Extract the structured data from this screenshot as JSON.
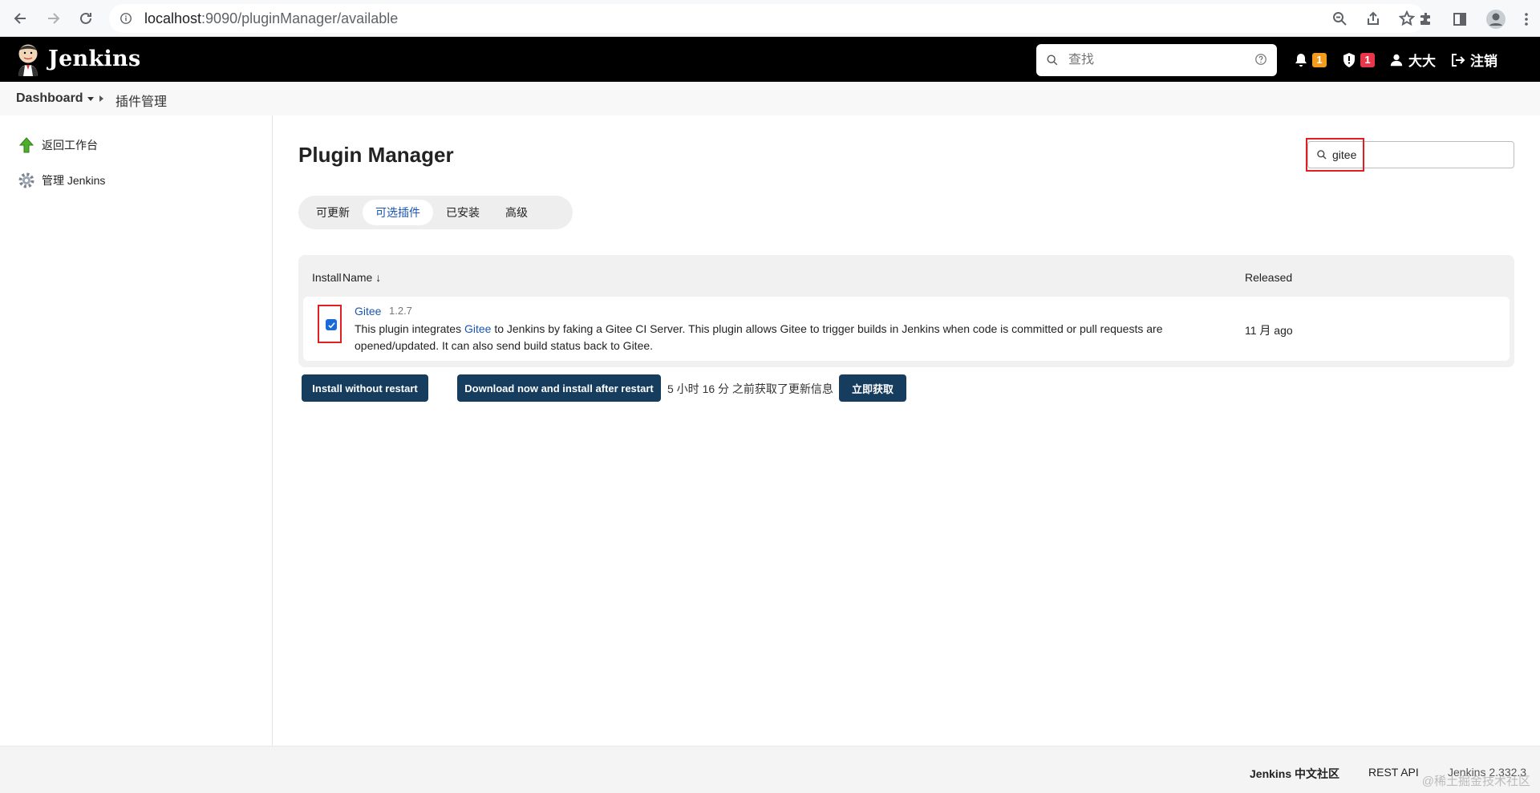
{
  "browser": {
    "url_host": "localhost",
    "url_rest": ":9090/pluginManager/available"
  },
  "header": {
    "title": "Jenkins",
    "search_placeholder": "查找",
    "notifications_count": "1",
    "security_count": "1",
    "user_name": "大大",
    "logout_label": "注销"
  },
  "breadcrumb": {
    "root": "Dashboard",
    "current": "插件管理"
  },
  "sidebar": {
    "items": [
      {
        "label": "返回工作台"
      },
      {
        "label": "管理 Jenkins"
      }
    ]
  },
  "main": {
    "title": "Plugin Manager",
    "filter_value": "gitee",
    "tabs": [
      {
        "label": "可更新"
      },
      {
        "label": "可选插件"
      },
      {
        "label": "已安装"
      },
      {
        "label": "高级"
      }
    ],
    "table": {
      "headers": {
        "install": "Install",
        "name": "Name ↓",
        "released": "Released"
      },
      "rows": [
        {
          "name": "Gitee",
          "version": "1.2.7",
          "desc_pre": "This plugin integrates ",
          "desc_link": "Gitee",
          "desc_post": " to Jenkins by faking a Gitee CI Server. This plugin allows Gitee to trigger builds in Jenkins when code is committed or pull requests are opened/updated. It can also send build status back to Gitee.",
          "released": "11 月 ago",
          "checked": true
        }
      ]
    },
    "install_without_restart": "Install without restart",
    "download_install_after_restart": "Download now and install after restart",
    "update_info": "5 小时 16 分 之前获取了更新信息",
    "fetch_now": "立即获取"
  },
  "footer": {
    "community": "Jenkins 中文社区",
    "rest_api": "REST API",
    "version": "Jenkins 2.332.3",
    "watermark": "@稀土掘金技术社区"
  },
  "colors": {
    "header_bg": "#000000",
    "badge_warning": "#f29b1d",
    "badge_danger": "#e8374b",
    "primary_button": "#163c5e",
    "link": "#1a56b0",
    "highlight_box": "#e02020"
  }
}
